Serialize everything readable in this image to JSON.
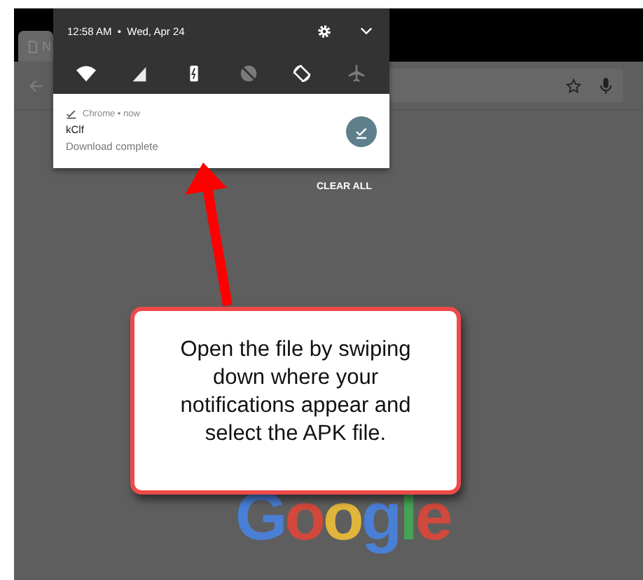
{
  "status": {
    "time": "12:58 AM",
    "separator": "•",
    "date": "Wed, Apr 24"
  },
  "quick_settings": [
    {
      "kind": "wifi",
      "on": true
    },
    {
      "kind": "signal",
      "on": true
    },
    {
      "kind": "battery",
      "on": true
    },
    {
      "kind": "dnd",
      "on": false
    },
    {
      "kind": "rotate",
      "on": true
    },
    {
      "kind": "airplane",
      "on": false
    }
  ],
  "notification": {
    "app": "Chrome • now",
    "title": "kClf",
    "text": "Download complete"
  },
  "clear_all": "CLEAR ALL",
  "browser": {
    "tab_title": "N",
    "logo": "Google"
  },
  "callout": {
    "text": "Open the file by swiping down where your notifications appear and select the APK file."
  }
}
